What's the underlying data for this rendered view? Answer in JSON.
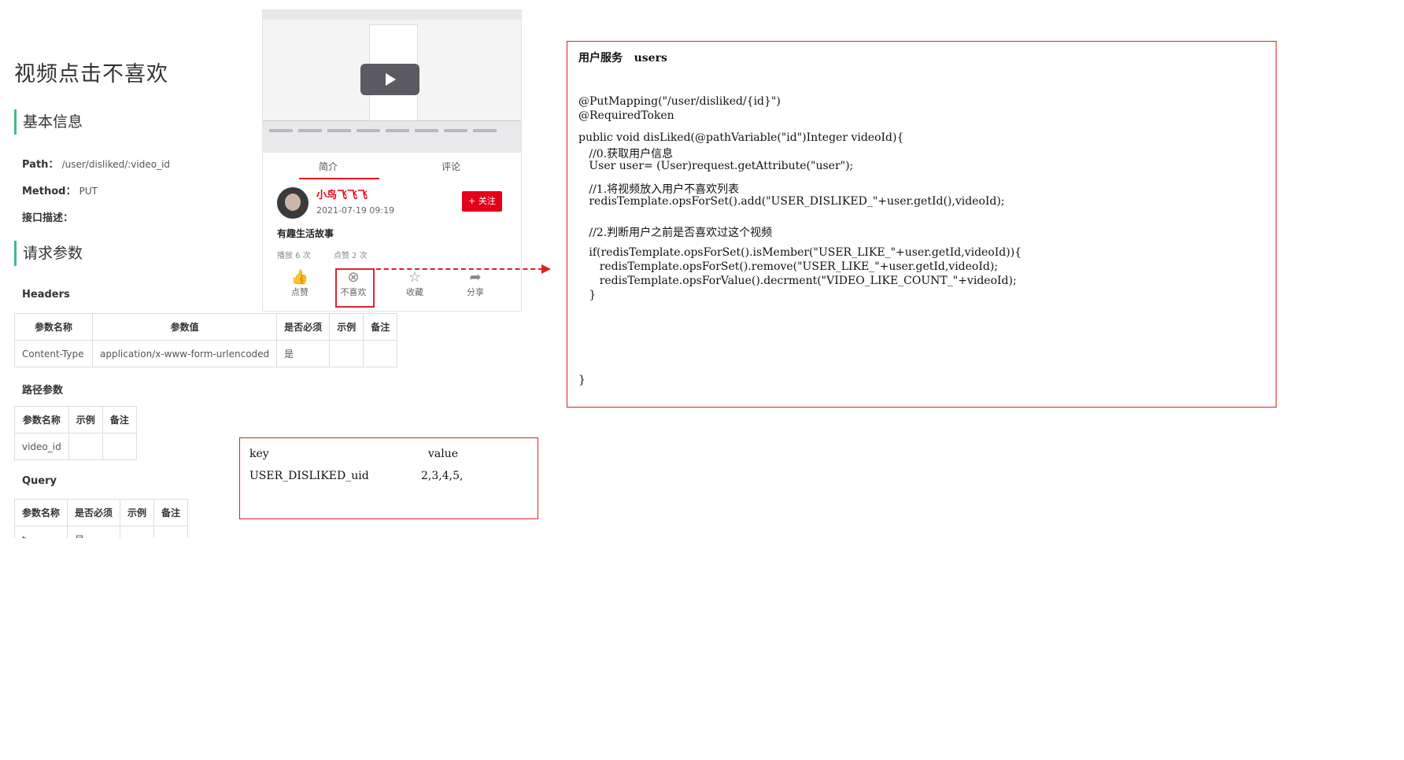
{
  "doc": {
    "title": "视频点击不喜欢",
    "section_basic": "基本信息",
    "path_label": "Path：",
    "path_value": "/user/disliked/:video_id",
    "method_label": "Method：",
    "method_value": "PUT",
    "desc_label": "接口描述：",
    "section_params": "请求参数",
    "headers_label": "Headers",
    "headers_cols": [
      "参数名称",
      "参数值",
      "是否必须",
      "示例",
      "备注"
    ],
    "headers_row": [
      "Content-Type",
      "application/x-www-form-urlencoded",
      "是",
      "",
      ""
    ],
    "path_params_label": "路径参数",
    "path_cols": [
      "参数名称",
      "示例",
      "备注"
    ],
    "path_row": [
      "video_id",
      "",
      ""
    ],
    "query_label": "Query",
    "query_cols": [
      "参数名称",
      "是否必须",
      "示例",
      "备注"
    ],
    "query_row_partial": [
      "t ...",
      "是",
      "",
      ""
    ]
  },
  "video": {
    "tab_intro": "简介",
    "tab_comments": "评论",
    "username": "小鸟飞飞飞",
    "date": "2021-07-19 09:19",
    "follow": "+ 关注",
    "title": "有趣生活故事",
    "plays": "播放 6 次",
    "likes": "点赞 2 次",
    "actions": [
      {
        "label": "点赞",
        "icon": "thumbs-up-icon",
        "glyph": "👍"
      },
      {
        "label": "不喜欢",
        "icon": "dislike-circle-x-icon",
        "glyph": "⊗"
      },
      {
        "label": "收藏",
        "icon": "star-icon",
        "glyph": "☆"
      },
      {
        "label": "分享",
        "icon": "share-icon",
        "glyph": "➦"
      }
    ]
  },
  "code": {
    "header": "用户服务   users",
    "lines": [
      "@PutMapping(\"/user/disliked/{id}\")",
      "@RequiredToken",
      "public void disLiked(@pathVariable(\"id\")Integer videoId){",
      "   //0.获取用户信息",
      "   User user= (User)request.getAttribute(\"user\");",
      "   //1.将视频放入用户不喜欢列表",
      "   redisTemplate.opsForSet().add(\"USER_DISLIKED_\"+user.getId(),videoId);",
      "   //2.判断用户之前是否喜欢过这个视频",
      "   if(redisTemplate.opsForSet().isMember(\"USER_LIKE_\"+user.getId,videoId)){",
      "      redisTemplate.opsForSet().remove(\"USER_LIKE_\"+user.getId,videoId);",
      "      redisTemplate.opsForValue().decrment(\"VIDEO_LIKE_COUNT_\"+videoId);",
      "   }",
      "}"
    ]
  },
  "kv": {
    "key_header": "key",
    "value_header": "value",
    "key": "USER_DISLIKED_uid",
    "value": "2,3,4,5,"
  }
}
